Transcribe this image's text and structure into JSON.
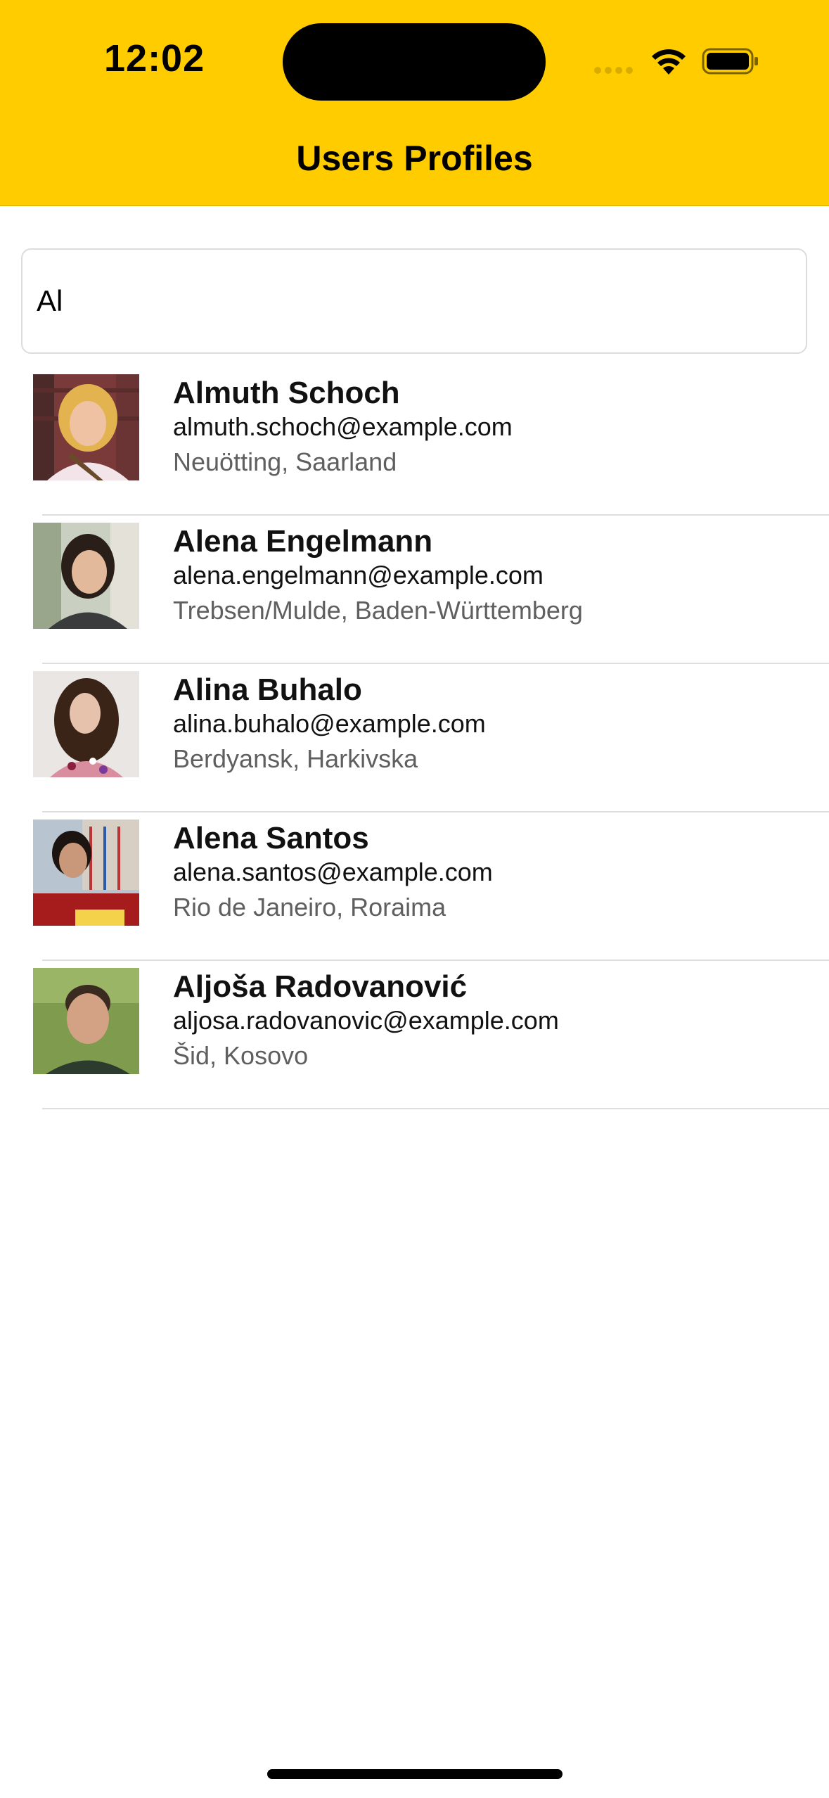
{
  "colors": {
    "header_bg": "#FFCC00",
    "text_primary": "#111111",
    "text_secondary": "#5F5F5F",
    "divider": "#DEDEDE"
  },
  "status_bar": {
    "time": "12:02",
    "icons": [
      "signal-icon",
      "wifi-icon",
      "battery-icon"
    ]
  },
  "nav": {
    "title": "Users Profiles"
  },
  "search": {
    "value": "Al",
    "placeholder": ""
  },
  "users": [
    {
      "name": "Almuth Schoch",
      "email": "almuth.schoch@example.com",
      "location": "Neuötting, Saarland"
    },
    {
      "name": "Alena Engelmann",
      "email": "alena.engelmann@example.com",
      "location": "Trebsen/Mulde, Baden-Württemberg"
    },
    {
      "name": "Alina Buhalo",
      "email": "alina.buhalo@example.com",
      "location": "Berdyansk, Harkivska"
    },
    {
      "name": "Alena Santos",
      "email": "alena.santos@example.com",
      "location": "Rio de Janeiro, Roraima"
    },
    {
      "name": "Aljoša Radovanović",
      "email": "aljosa.radovanovic@example.com",
      "location": "Šid, Kosovo"
    }
  ]
}
